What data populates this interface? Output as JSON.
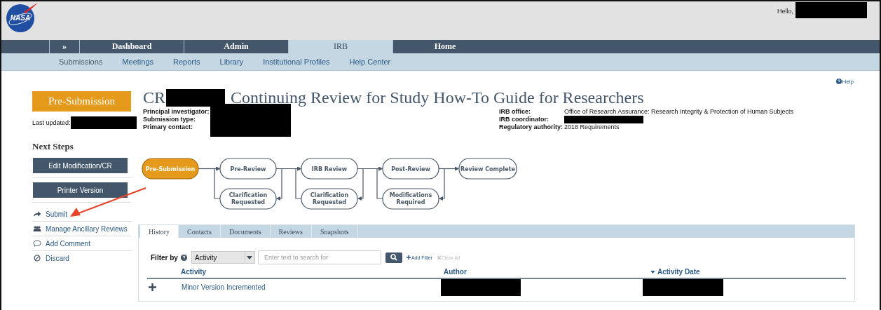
{
  "header": {
    "logo": "NASA",
    "greeting": "Hello,",
    "user_redacted": true
  },
  "nav": {
    "tabs": [
      {
        "label": "»",
        "selected": false
      },
      {
        "label": "Dashboard",
        "selected": false
      },
      {
        "label": "Admin",
        "selected": false
      },
      {
        "label": "IRB",
        "selected": true
      },
      {
        "label": "Home",
        "selected": false
      }
    ]
  },
  "subnav": {
    "items": [
      {
        "label": "Submissions",
        "selected": true
      },
      {
        "label": "Meetings",
        "selected": false
      },
      {
        "label": "Reports",
        "selected": false
      },
      {
        "label": "Library",
        "selected": false
      },
      {
        "label": "Institutional Profiles",
        "selected": false
      },
      {
        "label": "Help Center",
        "selected": false
      }
    ]
  },
  "help": "Help",
  "sidebar": {
    "state": "Pre-Submission",
    "last_updated_label": "Last updated:",
    "last_updated_redacted": true,
    "next_steps_title": "Next Steps",
    "buttons": [
      "Edit Modification/CR",
      "Printer Version"
    ],
    "actions": [
      {
        "label": "Submit",
        "kind": "share"
      },
      {
        "label": "Manage Ancillary Reviews",
        "kind": "users"
      },
      {
        "label": "Add Comment",
        "kind": "comment"
      },
      {
        "label": "Discard",
        "kind": "ban"
      }
    ]
  },
  "title": {
    "prefix": "CR",
    "prefix_redacted": true,
    "text": "Continuing Review for Study How-To Guide for Researchers"
  },
  "details_left": {
    "labels": [
      "Principal investigator:",
      "Submission type:",
      "Primary contact:"
    ],
    "values_redacted": true
  },
  "details_right": [
    {
      "label": "IRB office:",
      "value": "Office of Research Assurance: Research Integrity & Protection of Human Subjects",
      "redacted": false
    },
    {
      "label": "IRB coordinator:",
      "redacted": true
    },
    {
      "label": "Regulatory authority:",
      "value": "2018 Requirements",
      "redacted": false
    }
  ],
  "workflow": {
    "steps": [
      {
        "label": "Pre-Submission",
        "current": true
      },
      {
        "label": "Pre-Review",
        "current": false,
        "loop": "Clarification Requested"
      },
      {
        "label": "IRB Review",
        "current": false,
        "loop": "Clarification Requested"
      },
      {
        "label": "Post-Review",
        "current": false,
        "loop": "Modifications Required"
      },
      {
        "label": "Review Complete",
        "current": false
      }
    ]
  },
  "tabs": [
    {
      "label": "History",
      "selected": true
    },
    {
      "label": "Contacts",
      "selected": false
    },
    {
      "label": "Documents",
      "selected": false
    },
    {
      "label": "Reviews",
      "selected": false
    },
    {
      "label": "Snapshots",
      "selected": false
    }
  ],
  "filter": {
    "label": "Filter by",
    "field": "Activity",
    "placeholder": "Enter text to search for",
    "add_filter": "Add Filter",
    "clear_all": "Clear All",
    "clear_disabled": true
  },
  "table": {
    "columns": [
      {
        "label": "Activity",
        "sorted": false
      },
      {
        "label": "Author",
        "sorted": false
      },
      {
        "label": "Activity Date",
        "sorted": true
      }
    ],
    "rows": [
      {
        "activity": "Minor Version Incremented",
        "author_redacted": true,
        "date_redacted": true
      }
    ]
  }
}
